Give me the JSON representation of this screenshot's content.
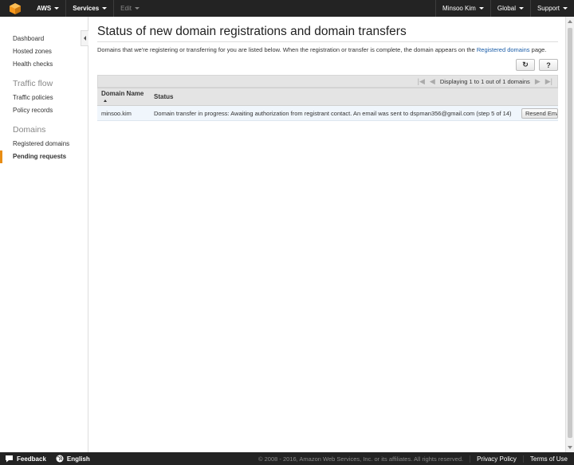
{
  "topnav": {
    "aws": "AWS",
    "services": "Services",
    "edit": "Edit",
    "user": "Minsoo Kim",
    "region": "Global",
    "support": "Support"
  },
  "sidebar": {
    "items_top": [
      "Dashboard",
      "Hosted zones",
      "Health checks"
    ],
    "section_traffic": "Traffic flow",
    "items_traffic": [
      "Traffic policies",
      "Policy records"
    ],
    "section_domains": "Domains",
    "items_domains": [
      "Registered domains",
      "Pending requests"
    ]
  },
  "main": {
    "title": "Status of new domain registrations and domain transfers",
    "desc_prefix": "Domains that we're registering or transferring for you are listed below. When the registration or transfer is complete, the domain appears on the",
    "desc_link": "Registered domains",
    "desc_suffix": "page.",
    "refresh_glyph": "↻",
    "help_glyph": "?",
    "pager_text": "Displaying 1 to 1 out of 1 domains",
    "pager_first": "|◀",
    "pager_prev": "◀",
    "pager_next": "▶",
    "pager_last": "▶|"
  },
  "table": {
    "headers": [
      "Domain Name",
      "Status"
    ],
    "rows": [
      {
        "domain": "minsoo.kim",
        "status": "Domain transfer in progress: Awaiting authorization from registrant contact. An email was sent to dspman356@gmail.com (step 5 of 14)",
        "action": "Resend Email"
      }
    ]
  },
  "footer": {
    "feedback": "Feedback",
    "language": "English",
    "copyright": "© 2008 - 2016, Amazon Web Services, Inc. or its affiliates. All rights reserved.",
    "privacy": "Privacy Policy",
    "terms": "Terms of Use"
  },
  "colors": {
    "nav_bg": "#232323",
    "accent": "#e88d14",
    "link": "#1a5da8",
    "row_bg": "#f0f6fc"
  }
}
